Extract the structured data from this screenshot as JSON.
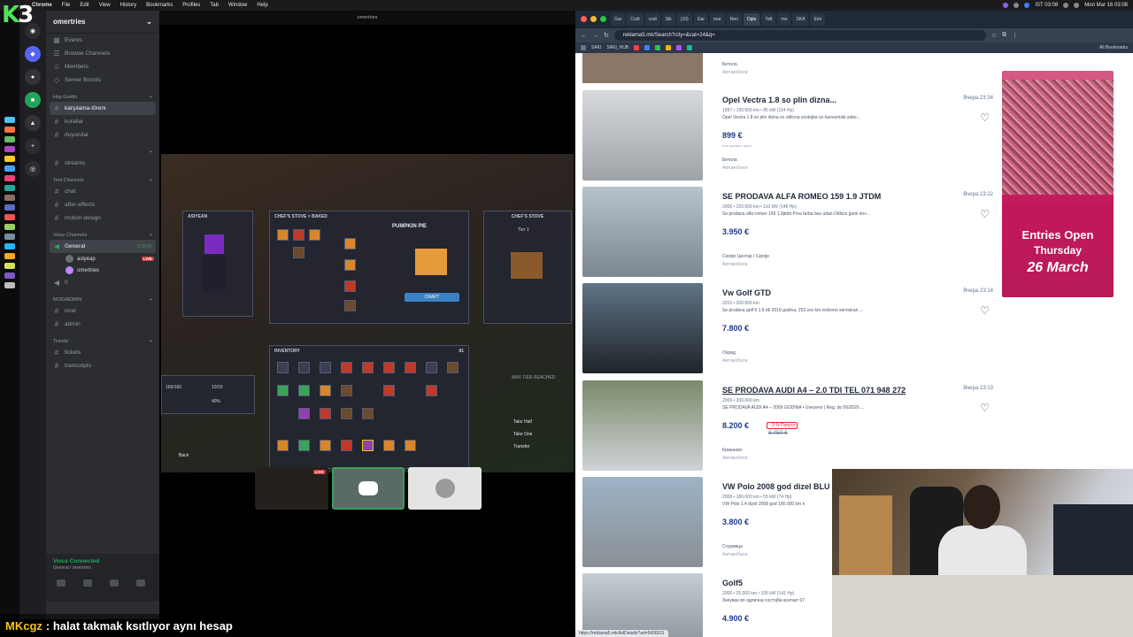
{
  "menubar": {
    "app": "Chrome",
    "items": [
      "File",
      "Edit",
      "View",
      "History",
      "Bookmarks",
      "Profiles",
      "Tab",
      "Window",
      "Help"
    ],
    "datetime": "Mon Mar 16 03:08",
    "clock_alt": "IST 03:08"
  },
  "discord": {
    "guild_name": "omertries",
    "top_items": [
      "Events",
      "Browse Channels",
      "Members",
      "Server Boosts"
    ],
    "categories": [
      {
        "name": "Hoş Geldin",
        "channels": [
          "karşılama-töreni",
          "kurallar",
          "duyurular"
        ]
      },
      {
        "name": "",
        "channels": [
          "streams"
        ]
      },
      {
        "name": "Text Channels",
        "channels": [
          "chat",
          "after-effects",
          "motion-design"
        ]
      },
      {
        "name": "Voice Channels",
        "channels": [
          "General"
        ]
      },
      {
        "name": "MOD/ADMIN",
        "channels": [
          "mod",
          "admin"
        ]
      },
      {
        "name": "Tickets",
        "channels": [
          "tickets",
          "transcripts"
        ]
      }
    ],
    "voice_users": [
      {
        "name": "aslyeap",
        "live": "LIVE"
      },
      {
        "name": "omertries",
        "live": ""
      }
    ],
    "voice_timer": "5:39:47",
    "voice_count": "0",
    "voice_connected": "Voice Connected",
    "voice_connected_sub": "General / omertries"
  },
  "stream": {
    "title": "omertries",
    "game_panels": {
      "left_title": "ASIYEAN",
      "stove_title": "CHEF'S STOVE > BAKED",
      "recipe_title": "PUMPKIN PIE",
      "right_title": "CHEF'S STOVE",
      "tier": "Tier 1",
      "inventory_title": "INVENTORY",
      "inventory_count": "81",
      "craft_label": "CRAFT",
      "max_tier": "MAX TIER REACHED",
      "take_half": "Take Half",
      "take_one": "Take One",
      "transfer": "Transfer",
      "back": "Back",
      "stat_1": "160/160",
      "stat_2": "10/10",
      "stat_3": "40%"
    },
    "tiles": {
      "live_badge": "LIVE"
    }
  },
  "chat_overlay": {
    "user": "MKcgz",
    "message": ": halat takmak ksıtlıyor aynı hesap"
  },
  "browser": {
    "tabs": [
      "Gar",
      "Codi",
      "codi",
      "Sik",
      "(10)",
      "Gar",
      "mar",
      "Ren",
      "Oglu",
      "Taft",
      "mo",
      "SKA",
      "Emi"
    ],
    "active_tab_index": 8,
    "url": "reklama5.mk/Search?city=&cat=24&q=",
    "bookmarks": [
      "SAKI",
      "SAKI_HUB"
    ],
    "all_bookmarks": "All Bookmarks",
    "status_url": "https://reklama5.mk/AdDetails?ad=5606011"
  },
  "listings": {
    "top_partial": {
      "location": "Битола",
      "category": "Автомобили"
    },
    "items": [
      {
        "title": "Opel Vectra 1.8 so plin dizna...",
        "time": "Вчера 23:34",
        "meta": "1997 • 190.000 km • 85 kW (114 Hp)",
        "desc": "Opel Vectra 1.8 so plin dizna vo odlicna sostojba so karoseriski zabe...",
        "price": "899 €",
        "note": "или предлог цена",
        "location": "Битола",
        "category": "Автомобили",
        "underline": false
      },
      {
        "title": "SE PRODAVA ALFA ROMEO 159 1.9 JTDM",
        "time": "Вчера 23:22",
        "meta": "2006 • 220.000 km • 110 kW (148 Hp)",
        "desc": "Se prodava alfa romeo 159 1.9jtdm.Prva farba bez udari.Odlicni gumi im+...",
        "price": "3.950 €",
        "location": "Скопје Центар / Скопје",
        "category": "Автомобили",
        "underline": false
      },
      {
        "title": "Vw Golf GTD",
        "time": "Вчера 23:14",
        "meta": "2010 • 200.000 km",
        "desc": "Se prodava golf 6 1.6 tdi 2010 godina, 252.xxx km redovno servisiran ...",
        "price": "7.800 €",
        "location": "Охрид",
        "category": "Автомобили",
        "underline": false
      },
      {
        "title": "SE PRODAVA AUDI A4 – 2.0 TDI TEL 071 948 272",
        "time": "Вчера 23:13",
        "meta": "2009 • 200.000 km",
        "desc": "SE PRODAVA AUDI A4 – 2009 GODINA • Uvezeno | Reg. do 06/2026 ...",
        "price": "8.200 €",
        "discount": "- 3 % Попуст",
        "old_price": "8.450 €",
        "location": "Куманово",
        "category": "Автомобили",
        "underline": true
      },
      {
        "title": "VW Polo 2008 god dizel BLU",
        "time": "",
        "meta": "2008 • 180.000 km • 55 kW (74 Hp)",
        "desc": "VW Polo 1.4 dizel 2008 god 180.000 km n",
        "price": "3.800 €",
        "location": "Струмица",
        "category": "Автомобили",
        "underline": false
      },
      {
        "title": "Golf5",
        "time": "",
        "meta": "2006 • 25.000 km • 105 kW (141 Hp)",
        "desc": "Зачуван во одлична состојба контакт 07",
        "price": "4.900 €",
        "location": "",
        "category": "",
        "underline": false
      }
    ]
  },
  "ad": {
    "line1": "Entries Open",
    "line2": "Thursday",
    "line3": "26 March"
  },
  "colors": {
    "discord_bg": "#2b2d31",
    "voice_green": "#23a559",
    "price_blue": "#1e3a8a",
    "ad_pink": "#c2185b",
    "k3_green": "#55e05a"
  }
}
